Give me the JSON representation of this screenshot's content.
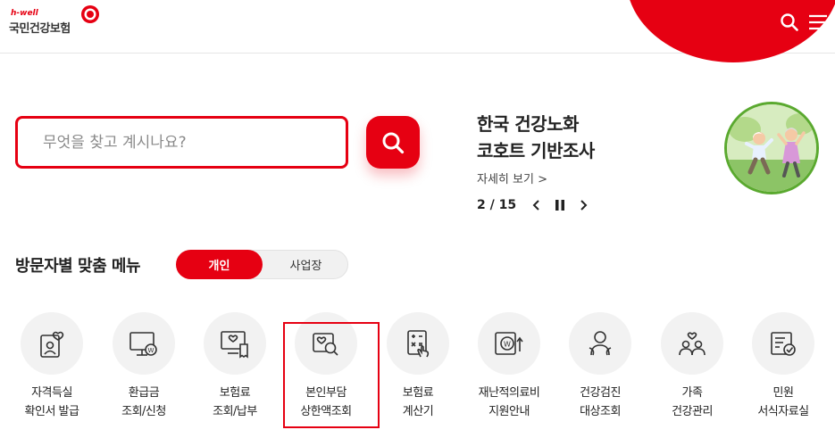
{
  "header": {
    "logo_sub": "h-well",
    "logo_main": "국민건강보험",
    "icons": [
      "search-icon",
      "hamburger-menu-icon"
    ]
  },
  "search": {
    "placeholder": "무엇을 찾고 계시나요?"
  },
  "banner": {
    "title_line1": "한국 건강노화",
    "title_line2": "코호트 기반조사",
    "more": "자세히 보기 >",
    "page": "2 / 15"
  },
  "menu": {
    "title": "방문자별 맞춤 메뉴",
    "toggle_on": "개인",
    "toggle_off": "사업장",
    "items": [
      {
        "line1": "자격득실",
        "line2": "확인서 발급",
        "icon": "certificate-user-icon"
      },
      {
        "line1": "환급금",
        "line2": "조회/신청",
        "icon": "monitor-won-icon"
      },
      {
        "line1": "보험료",
        "line2": "조회/납부",
        "icon": "receipt-heart-icon"
      },
      {
        "line1": "본인부담",
        "line2": "상한액조회",
        "icon": "heart-search-icon"
      },
      {
        "line1": "보험료",
        "line2": "계산기",
        "icon": "calculator-hand-icon"
      },
      {
        "line1": "재난적의료비",
        "line2": "지원안내",
        "icon": "won-support-icon"
      },
      {
        "line1": "건강검진",
        "line2": "대상조회",
        "icon": "checkup-person-icon"
      },
      {
        "line1": "가족",
        "line2": "건강관리",
        "icon": "family-heart-icon"
      },
      {
        "line1": "민원",
        "line2": "서식자료실",
        "icon": "form-document-icon"
      }
    ]
  },
  "colors": {
    "accent": "#e60012",
    "highlight_border": "#e60012"
  }
}
